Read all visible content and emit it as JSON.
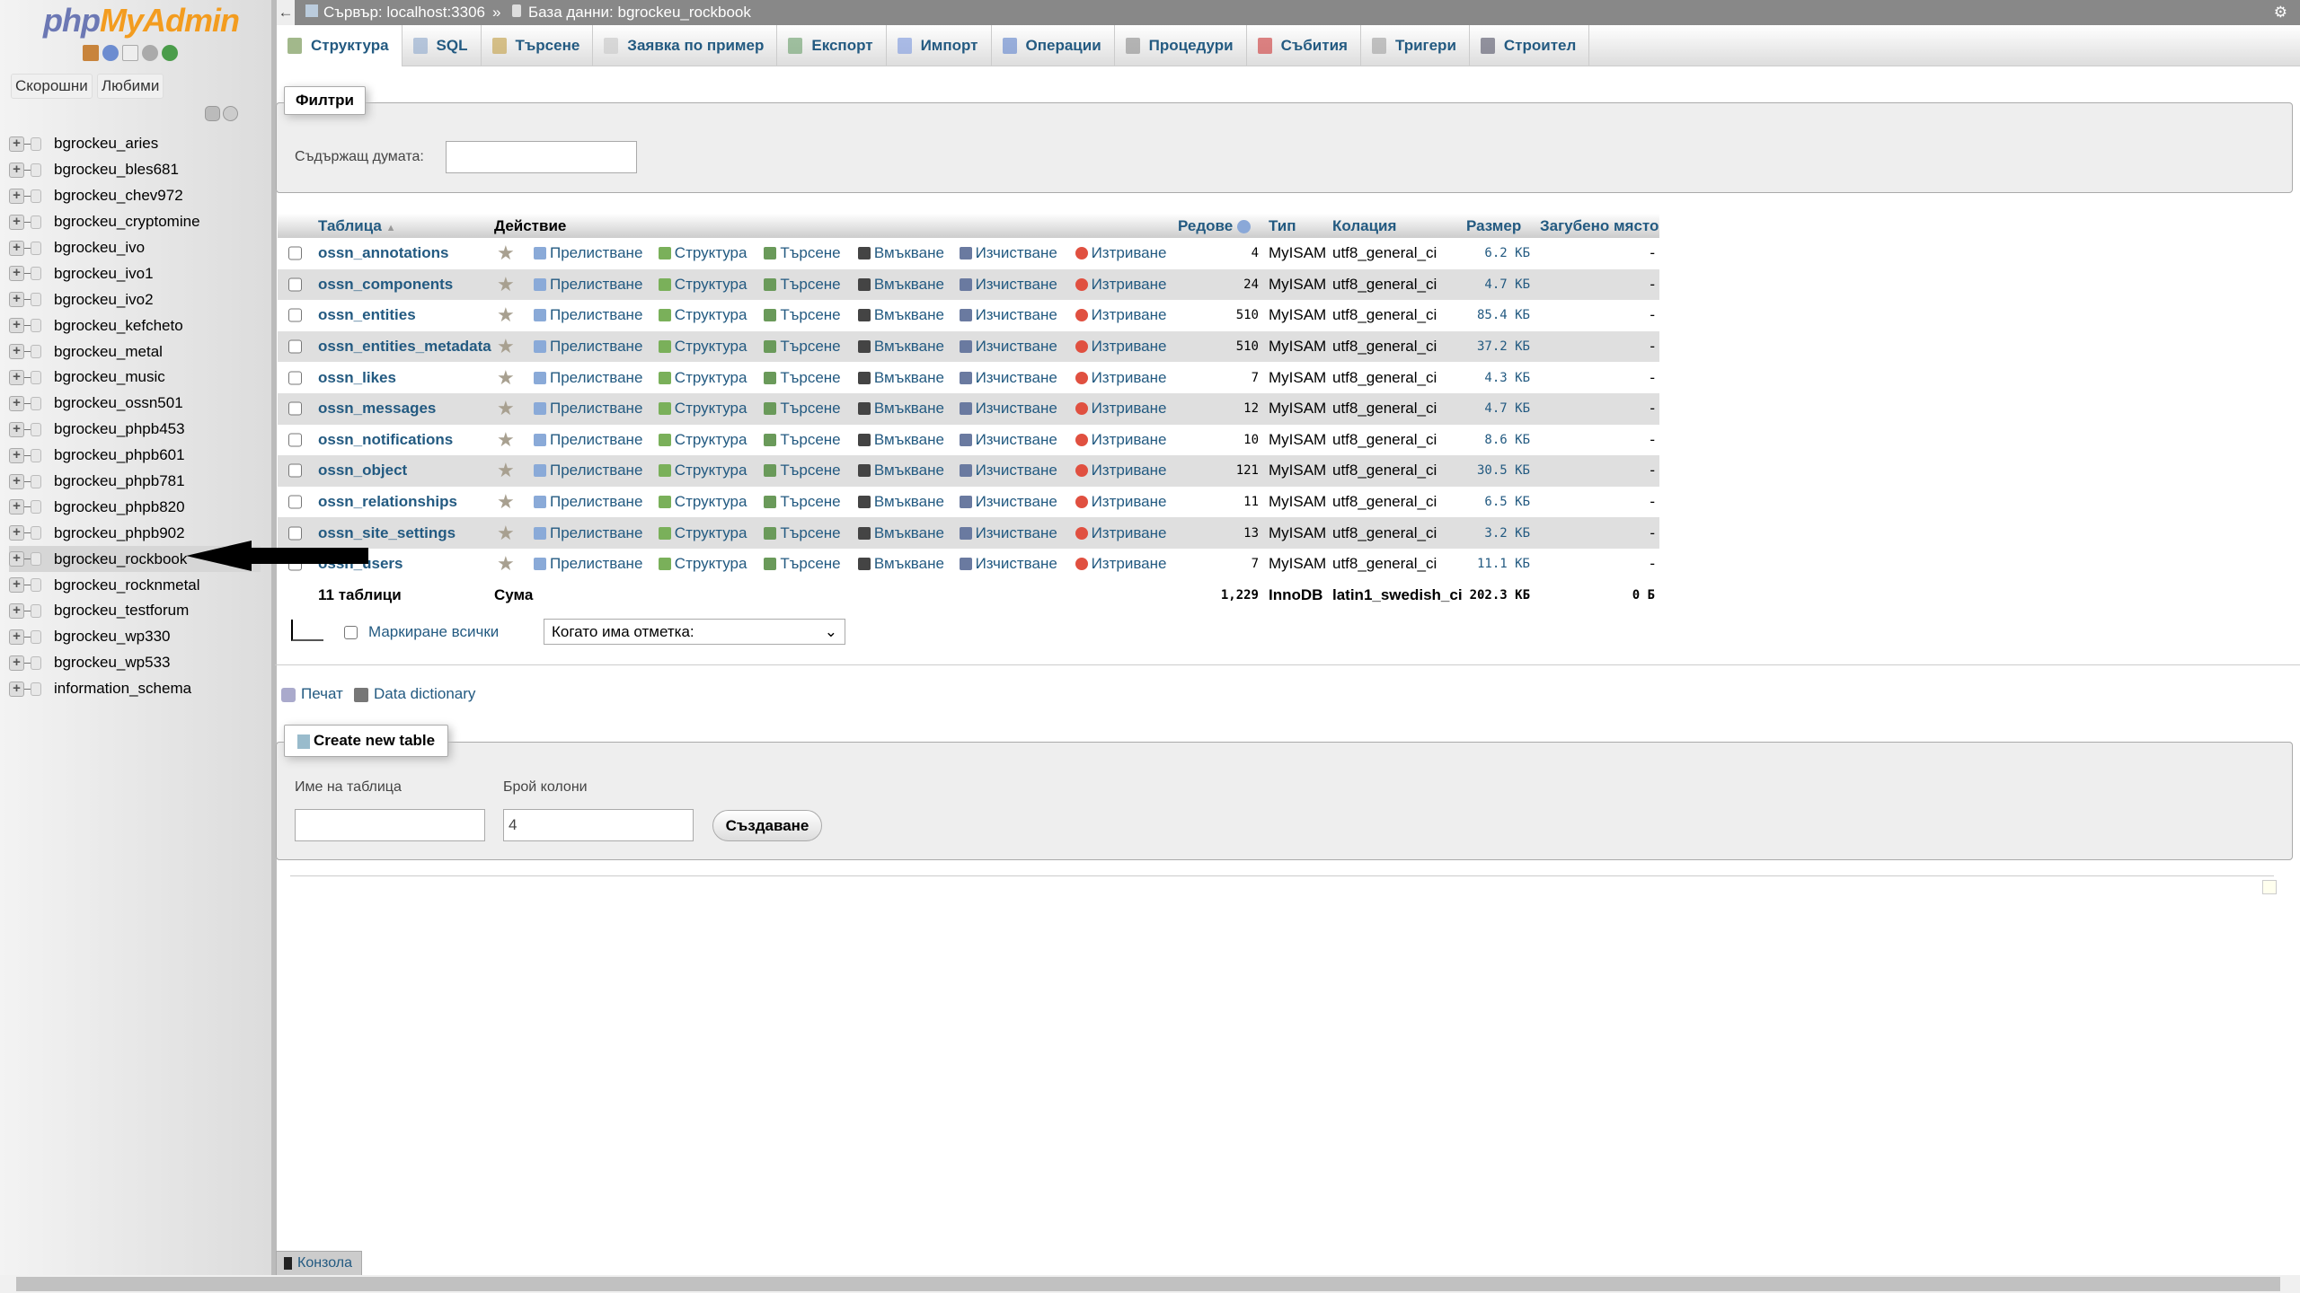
{
  "sidebar": {
    "logo_php": "php",
    "logo_my": "MyAdmin",
    "recent": "Скорошни",
    "favorites": "Любими",
    "databases": [
      "bgrockeu_aries",
      "bgrockeu_bles681",
      "bgrockeu_chev972",
      "bgrockeu_cryptomine",
      "bgrockeu_ivo",
      "bgrockeu_ivo1",
      "bgrockeu_ivo2",
      "bgrockeu_kefcheto",
      "bgrockeu_metal",
      "bgrockeu_music",
      "bgrockeu_ossn501",
      "bgrockeu_phpb453",
      "bgrockeu_phpb601",
      "bgrockeu_phpb781",
      "bgrockeu_phpb820",
      "bgrockeu_phpb902",
      "bgrockeu_rockbook",
      "bgrockeu_rocknmetal",
      "bgrockeu_testforum",
      "bgrockeu_wp330",
      "bgrockeu_wp533",
      "information_schema"
    ],
    "selected": "bgrockeu_rockbook"
  },
  "breadcrumb": {
    "server": "Сървър: localhost:3306",
    "sep": "»",
    "database": "База данни: bgrockeu_rockbook"
  },
  "tabs": [
    "Структура",
    "SQL",
    "Търсене",
    "Заявка по пример",
    "Експорт",
    "Импорт",
    "Операции",
    "Процедури",
    "Събития",
    "Тригери",
    "Строител"
  ],
  "filters": {
    "legend": "Филтри",
    "label": "Съдържащ думата:",
    "value": ""
  },
  "table": {
    "headers": {
      "table": "Таблица",
      "action": "Действие",
      "rows": "Редове",
      "type": "Тип",
      "collation": "Колация",
      "size": "Размер",
      "overhead": "Загубено място"
    },
    "actions": [
      "Прелистване",
      "Структура",
      "Търсене",
      "Вмъкване",
      "Изчистване",
      "Изтриване"
    ],
    "rows": [
      [
        "ossn_annotations",
        "4",
        "MyISAM",
        "utf8_general_ci",
        "6.2 КБ",
        "-"
      ],
      [
        "ossn_components",
        "24",
        "MyISAM",
        "utf8_general_ci",
        "4.7 КБ",
        "-"
      ],
      [
        "ossn_entities",
        "510",
        "MyISAM",
        "utf8_general_ci",
        "85.4 КБ",
        "-"
      ],
      [
        "ossn_entities_metadata",
        "510",
        "MyISAM",
        "utf8_general_ci",
        "37.2 КБ",
        "-"
      ],
      [
        "ossn_likes",
        "7",
        "MyISAM",
        "utf8_general_ci",
        "4.3 КБ",
        "-"
      ],
      [
        "ossn_messages",
        "12",
        "MyISAM",
        "utf8_general_ci",
        "4.7 КБ",
        "-"
      ],
      [
        "ossn_notifications",
        "10",
        "MyISAM",
        "utf8_general_ci",
        "8.6 КБ",
        "-"
      ],
      [
        "ossn_object",
        "121",
        "MyISAM",
        "utf8_general_ci",
        "30.5 КБ",
        "-"
      ],
      [
        "ossn_relationships",
        "11",
        "MyISAM",
        "utf8_general_ci",
        "6.5 КБ",
        "-"
      ],
      [
        "ossn_site_settings",
        "13",
        "MyISAM",
        "utf8_general_ci",
        "3.2 КБ",
        "-"
      ],
      [
        "ossn_users",
        "7",
        "MyISAM",
        "utf8_general_ci",
        "11.1 КБ",
        "-"
      ]
    ],
    "footer": {
      "count": "11 таблици",
      "sum": "Сума",
      "rows": "1,229",
      "type": "InnoDB",
      "collation": "latin1_swedish_ci",
      "size": "202.3 КБ",
      "overhead": "0 Б"
    }
  },
  "bulk": {
    "check_all": "Маркиране всички",
    "select": "Когато има отметка:"
  },
  "links": {
    "print": "Печат",
    "dictionary": "Data dictionary"
  },
  "create": {
    "legend": "Create new table",
    "name_label": "Име на таблица",
    "name_value": "",
    "cols_label": "Брой колони",
    "cols_value": "4",
    "button": "Създаване"
  },
  "console": "Конзола"
}
